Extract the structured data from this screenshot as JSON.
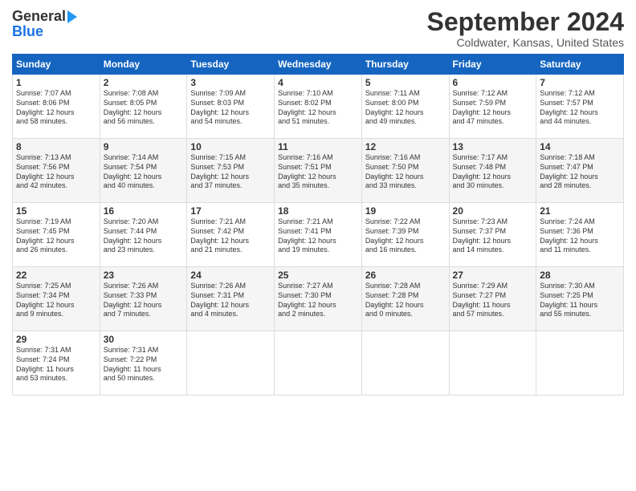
{
  "logo": {
    "line1": "General",
    "line2": "Blue"
  },
  "title": "September 2024",
  "subtitle": "Coldwater, Kansas, United States",
  "days_of_week": [
    "Sunday",
    "Monday",
    "Tuesday",
    "Wednesday",
    "Thursday",
    "Friday",
    "Saturday"
  ],
  "weeks": [
    [
      {
        "num": "1",
        "lines": [
          "Sunrise: 7:07 AM",
          "Sunset: 8:06 PM",
          "Daylight: 12 hours",
          "and 58 minutes."
        ]
      },
      {
        "num": "2",
        "lines": [
          "Sunrise: 7:08 AM",
          "Sunset: 8:05 PM",
          "Daylight: 12 hours",
          "and 56 minutes."
        ]
      },
      {
        "num": "3",
        "lines": [
          "Sunrise: 7:09 AM",
          "Sunset: 8:03 PM",
          "Daylight: 12 hours",
          "and 54 minutes."
        ]
      },
      {
        "num": "4",
        "lines": [
          "Sunrise: 7:10 AM",
          "Sunset: 8:02 PM",
          "Daylight: 12 hours",
          "and 51 minutes."
        ]
      },
      {
        "num": "5",
        "lines": [
          "Sunrise: 7:11 AM",
          "Sunset: 8:00 PM",
          "Daylight: 12 hours",
          "and 49 minutes."
        ]
      },
      {
        "num": "6",
        "lines": [
          "Sunrise: 7:12 AM",
          "Sunset: 7:59 PM",
          "Daylight: 12 hours",
          "and 47 minutes."
        ]
      },
      {
        "num": "7",
        "lines": [
          "Sunrise: 7:12 AM",
          "Sunset: 7:57 PM",
          "Daylight: 12 hours",
          "and 44 minutes."
        ]
      }
    ],
    [
      {
        "num": "8",
        "lines": [
          "Sunrise: 7:13 AM",
          "Sunset: 7:56 PM",
          "Daylight: 12 hours",
          "and 42 minutes."
        ]
      },
      {
        "num": "9",
        "lines": [
          "Sunrise: 7:14 AM",
          "Sunset: 7:54 PM",
          "Daylight: 12 hours",
          "and 40 minutes."
        ]
      },
      {
        "num": "10",
        "lines": [
          "Sunrise: 7:15 AM",
          "Sunset: 7:53 PM",
          "Daylight: 12 hours",
          "and 37 minutes."
        ]
      },
      {
        "num": "11",
        "lines": [
          "Sunrise: 7:16 AM",
          "Sunset: 7:51 PM",
          "Daylight: 12 hours",
          "and 35 minutes."
        ]
      },
      {
        "num": "12",
        "lines": [
          "Sunrise: 7:16 AM",
          "Sunset: 7:50 PM",
          "Daylight: 12 hours",
          "and 33 minutes."
        ]
      },
      {
        "num": "13",
        "lines": [
          "Sunrise: 7:17 AM",
          "Sunset: 7:48 PM",
          "Daylight: 12 hours",
          "and 30 minutes."
        ]
      },
      {
        "num": "14",
        "lines": [
          "Sunrise: 7:18 AM",
          "Sunset: 7:47 PM",
          "Daylight: 12 hours",
          "and 28 minutes."
        ]
      }
    ],
    [
      {
        "num": "15",
        "lines": [
          "Sunrise: 7:19 AM",
          "Sunset: 7:45 PM",
          "Daylight: 12 hours",
          "and 26 minutes."
        ]
      },
      {
        "num": "16",
        "lines": [
          "Sunrise: 7:20 AM",
          "Sunset: 7:44 PM",
          "Daylight: 12 hours",
          "and 23 minutes."
        ]
      },
      {
        "num": "17",
        "lines": [
          "Sunrise: 7:21 AM",
          "Sunset: 7:42 PM",
          "Daylight: 12 hours",
          "and 21 minutes."
        ]
      },
      {
        "num": "18",
        "lines": [
          "Sunrise: 7:21 AM",
          "Sunset: 7:41 PM",
          "Daylight: 12 hours",
          "and 19 minutes."
        ]
      },
      {
        "num": "19",
        "lines": [
          "Sunrise: 7:22 AM",
          "Sunset: 7:39 PM",
          "Daylight: 12 hours",
          "and 16 minutes."
        ]
      },
      {
        "num": "20",
        "lines": [
          "Sunrise: 7:23 AM",
          "Sunset: 7:37 PM",
          "Daylight: 12 hours",
          "and 14 minutes."
        ]
      },
      {
        "num": "21",
        "lines": [
          "Sunrise: 7:24 AM",
          "Sunset: 7:36 PM",
          "Daylight: 12 hours",
          "and 11 minutes."
        ]
      }
    ],
    [
      {
        "num": "22",
        "lines": [
          "Sunrise: 7:25 AM",
          "Sunset: 7:34 PM",
          "Daylight: 12 hours",
          "and 9 minutes."
        ]
      },
      {
        "num": "23",
        "lines": [
          "Sunrise: 7:26 AM",
          "Sunset: 7:33 PM",
          "Daylight: 12 hours",
          "and 7 minutes."
        ]
      },
      {
        "num": "24",
        "lines": [
          "Sunrise: 7:26 AM",
          "Sunset: 7:31 PM",
          "Daylight: 12 hours",
          "and 4 minutes."
        ]
      },
      {
        "num": "25",
        "lines": [
          "Sunrise: 7:27 AM",
          "Sunset: 7:30 PM",
          "Daylight: 12 hours",
          "and 2 minutes."
        ]
      },
      {
        "num": "26",
        "lines": [
          "Sunrise: 7:28 AM",
          "Sunset: 7:28 PM",
          "Daylight: 12 hours",
          "and 0 minutes."
        ]
      },
      {
        "num": "27",
        "lines": [
          "Sunrise: 7:29 AM",
          "Sunset: 7:27 PM",
          "Daylight: 11 hours",
          "and 57 minutes."
        ]
      },
      {
        "num": "28",
        "lines": [
          "Sunrise: 7:30 AM",
          "Sunset: 7:25 PM",
          "Daylight: 11 hours",
          "and 55 minutes."
        ]
      }
    ],
    [
      {
        "num": "29",
        "lines": [
          "Sunrise: 7:31 AM",
          "Sunset: 7:24 PM",
          "Daylight: 11 hours",
          "and 53 minutes."
        ]
      },
      {
        "num": "30",
        "lines": [
          "Sunrise: 7:31 AM",
          "Sunset: 7:22 PM",
          "Daylight: 11 hours",
          "and 50 minutes."
        ]
      },
      {
        "num": "",
        "lines": []
      },
      {
        "num": "",
        "lines": []
      },
      {
        "num": "",
        "lines": []
      },
      {
        "num": "",
        "lines": []
      },
      {
        "num": "",
        "lines": []
      }
    ]
  ]
}
